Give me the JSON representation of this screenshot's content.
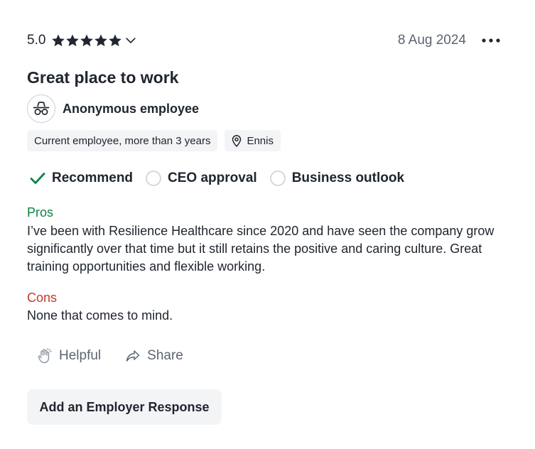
{
  "review": {
    "rating": "5.0",
    "stars": 5,
    "date": "8 Aug 2024",
    "title": "Great place to work",
    "author": "Anonymous employee",
    "employment_status": "Current employee, more than 3 years",
    "location": "Ennis"
  },
  "recommendations": [
    {
      "label": "Recommend",
      "state": "positive",
      "icon": "check-icon"
    },
    {
      "label": "CEO approval",
      "state": "none",
      "icon": "empty-circle-icon"
    },
    {
      "label": "Business outlook",
      "state": "none",
      "icon": "empty-circle-icon"
    }
  ],
  "pros": {
    "label": "Pros",
    "text": "I’ve been with Resilience Healthcare since 2020 and have seen the company grow significantly over that time but it still retains the positive and caring culture. Great training opportunities and flexible working."
  },
  "cons": {
    "label": "Cons",
    "text": "None that comes to mind."
  },
  "actions": {
    "helpful_label": "Helpful",
    "share_label": "Share"
  },
  "employer_response_label": "Add an Employer Response",
  "colors": {
    "pros": "#0e8345",
    "cons": "#c3392b",
    "check": "#0e8345",
    "muted": "#5b6470"
  }
}
